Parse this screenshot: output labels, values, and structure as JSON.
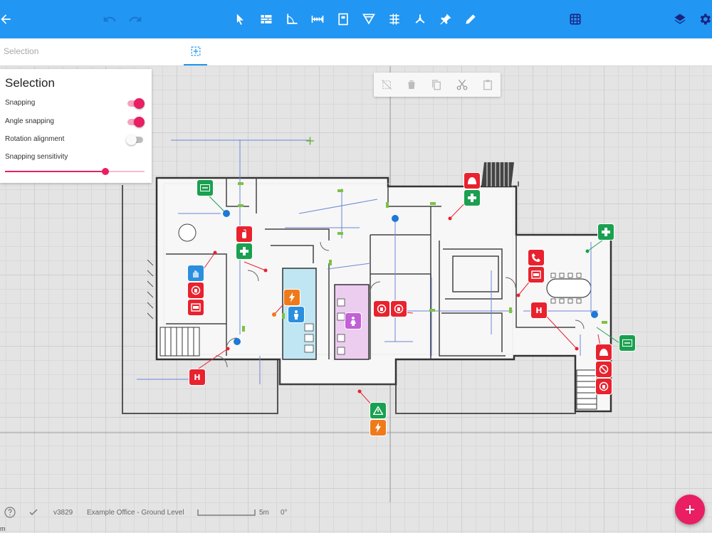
{
  "subbar": {
    "mode_label": "Selection"
  },
  "panel": {
    "title": "Selection",
    "options": [
      {
        "label": "Snapping",
        "enabled": true
      },
      {
        "label": "Angle snapping",
        "enabled": true
      },
      {
        "label": "Rotation alignment",
        "enabled": false
      }
    ],
    "sensitivity_label": "Snapping sensitivity",
    "sensitivity_value": 0.72
  },
  "status": {
    "version": "v3829",
    "plan_name": "Example Office - Ground Level",
    "scale_label": "5m",
    "rotation": "0°"
  },
  "markers": {
    "hydrant": "H"
  },
  "corner_letter": "m",
  "colors": {
    "primary": "#2196f3",
    "accent": "#e91e63",
    "safety_red": "#e8222e",
    "safety_green": "#1aa050",
    "warning_orange": "#f07a1a"
  }
}
